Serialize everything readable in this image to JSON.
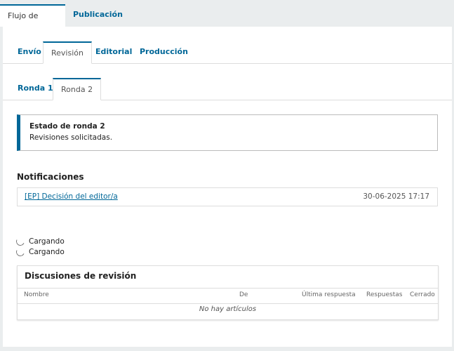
{
  "top_tabs": {
    "active": "Flujo de trabajo",
    "other": "Publicación"
  },
  "stage_tabs": [
    "Envío",
    "Revisión",
    "Editorial",
    "Producción"
  ],
  "round_tabs": [
    "Ronda 1",
    "Ronda 2"
  ],
  "round_status": {
    "title": "Estado de ronda 2",
    "text": "Revisiones solicitadas."
  },
  "notifications": {
    "heading": "Notificaciones",
    "items": [
      {
        "link": "[EP] Decisión del editor/a",
        "date": "30-06-2025 17:17"
      }
    ]
  },
  "loading": [
    "Cargando",
    "Cargando"
  ],
  "discussions": {
    "title": "Discusiones de revisión",
    "columns": [
      "Nombre",
      "De",
      "Última respuesta",
      "Respuestas",
      "Cerrado"
    ],
    "empty": "No hay artículos"
  },
  "colors": {
    "accent": "#006798",
    "background": "#eaedee"
  }
}
